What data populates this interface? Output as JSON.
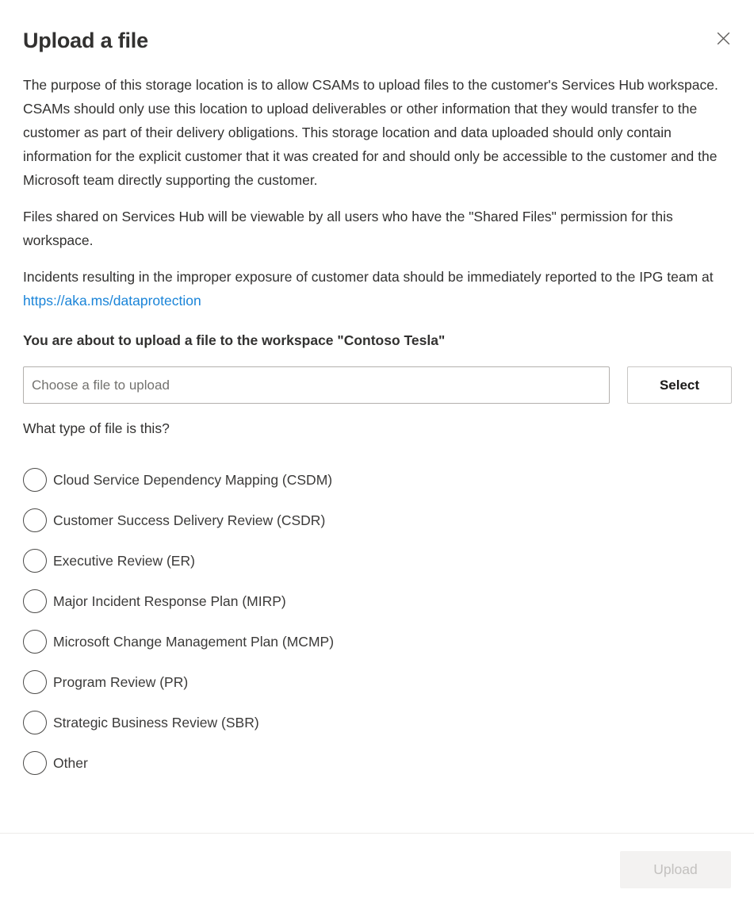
{
  "dialog": {
    "title": "Upload a file",
    "close_icon": "close-icon",
    "paragraphs": [
      "The purpose of this storage location is to allow CSAMs to upload files to the customer's Services Hub workspace. CSAMs should only use this location to upload deliverables or other information that they would transfer to the customer as part of their delivery obligations. This storage location and data uploaded should only contain information for the explicit customer that it was created for and should only be accessible to the customer and the Microsoft team directly supporting the customer.",
      "Files shared on Services Hub will be viewable by all users who have the \"Shared Files\" permission for this workspace."
    ],
    "incident_notice": {
      "text_before_link": "Incidents resulting in the improper exposure of customer data should be immediately reported to the IPG team at ",
      "link_text": "https://aka.ms/dataprotection",
      "link_color": "#1a84d8"
    },
    "workspace_notice": "You are about to upload a file to the workspace \"Contoso Tesla\""
  },
  "file_picker": {
    "input_value": "",
    "input_placeholder": "Choose a file to upload",
    "select_label": "Select"
  },
  "file_type": {
    "question": "What type of file is this?",
    "selected": null,
    "options": [
      {
        "label": "Cloud Service Dependency Mapping (CSDM)",
        "value": "CSDM"
      },
      {
        "label": "Customer Success Delivery Review (CSDR)",
        "value": "CSDR"
      },
      {
        "label": "Executive Review (ER)",
        "value": "ER"
      },
      {
        "label": "Major Incident Response Plan (MIRP)",
        "value": "MIRP"
      },
      {
        "label": "Microsoft Change Management Plan (MCMP)",
        "value": "MCMP"
      },
      {
        "label": "Program Review (PR)",
        "value": "PR"
      },
      {
        "label": "Strategic Business Review (SBR)",
        "value": "SBR"
      },
      {
        "label": "Other",
        "value": "Other"
      }
    ]
  },
  "footer": {
    "upload_label": "Upload",
    "upload_enabled": false
  },
  "colors": {
    "accent": "#0078d4",
    "link": "#1a84d8",
    "text": "#323130",
    "muted_text": "#73726f",
    "disabled_bg": "#f3f2f1",
    "disabled_text": "#c3c1bf",
    "border": "#b3b0ad",
    "divider": "#edebe9"
  }
}
